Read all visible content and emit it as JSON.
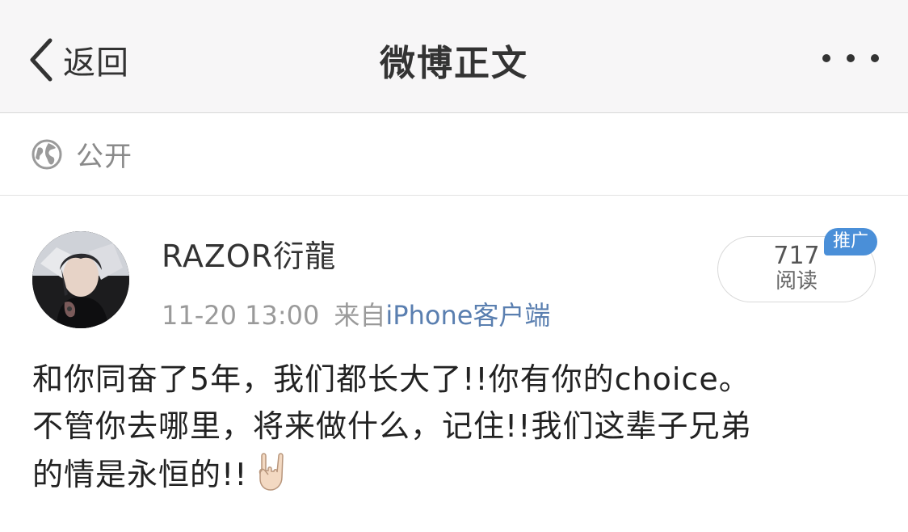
{
  "header": {
    "back_label": "返回",
    "title": "微博正文",
    "more_icon": "more-dots-icon"
  },
  "visibility": {
    "icon": "globe-icon",
    "label": "公开"
  },
  "post": {
    "author": "RAZOR衍龍",
    "time": "11-20 13:00",
    "source_prefix": "来自",
    "source_client": "iPhone客户端",
    "read_count": "717",
    "read_label": "阅读",
    "promo_badge": "推广",
    "text_lines": [
      "和你同奋了5年，我们都长大了!!你有你的choice。",
      "不管你去哪里，将来做什么，记住!!我们这辈子兄弟",
      "的情是永恒的!!"
    ],
    "emoji": "rock-on-hand-icon"
  },
  "colors": {
    "navbar_bg": "#f7f6f7",
    "link_blue": "#5a7fb0",
    "promo_blue": "#4a8fd8",
    "muted_gray": "#9a9a9a"
  }
}
